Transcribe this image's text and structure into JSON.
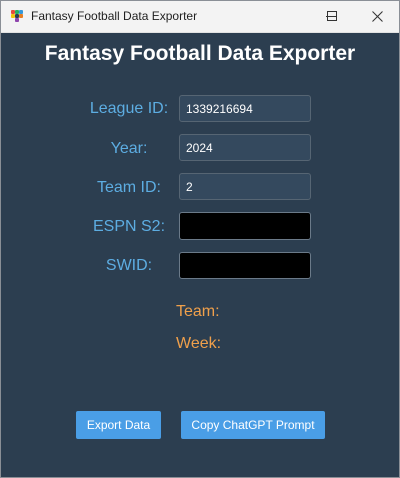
{
  "window": {
    "title": "Fantasy Football Data Exporter",
    "icon": "app-grid-icon",
    "controls": [
      "minimize-icon",
      "maximize-icon",
      "close-icon"
    ]
  },
  "header": {
    "title": "Fantasy Football Data Exporter"
  },
  "form": {
    "league_id": {
      "label": "League ID:",
      "value": "1339216694"
    },
    "year": {
      "label": "Year:",
      "value": "2024"
    },
    "team_id": {
      "label": "Team ID:",
      "value": "2"
    },
    "espn_s2": {
      "label": "ESPN S2:",
      "value": ""
    },
    "swid": {
      "label": "SWID:",
      "value": ""
    }
  },
  "info": {
    "team_label": "Team:",
    "week_label": "Week:"
  },
  "buttons": {
    "export_label": "Export Data",
    "copy_prompt_label": "Copy ChatGPT Prompt"
  },
  "colors": {
    "background": "#2c3e50",
    "title_text": "#ffffff",
    "form_label": "#5dade2",
    "info_label": "#f0a04b",
    "field_background": "#34495e",
    "secret_field_background": "#000000",
    "button": "#4a9ee6",
    "titlebar": "#f3f3f3"
  }
}
